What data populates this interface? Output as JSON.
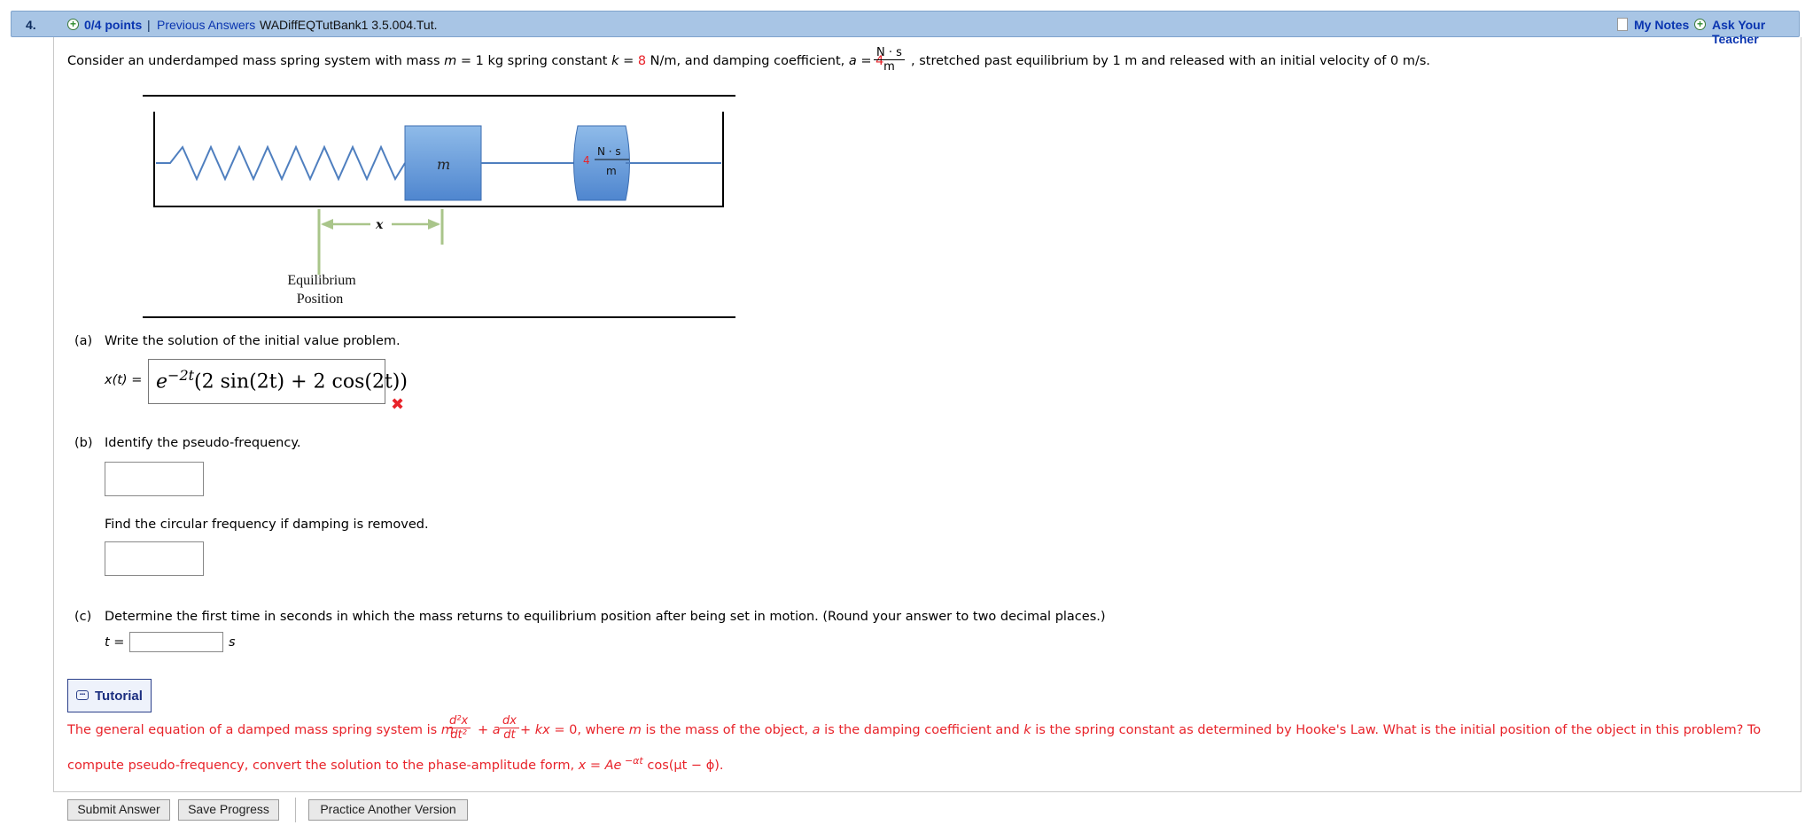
{
  "header": {
    "number": "4.",
    "points": "0/4 points",
    "separator": "|",
    "previous_answers": "Previous Answers",
    "code": "WADiffEQTutBank1 3.5.004.Tut.",
    "my_notes": "My Notes",
    "ask_teacher": "Ask Your Teacher"
  },
  "problem": {
    "p1": "Consider an underdamped mass spring system with mass ",
    "m_var": "m",
    "p2": " = 1 kg spring constant ",
    "k_var": "k",
    "p3": " = ",
    "k_val": "8",
    "p4": " N/m, and damping coefficient, ",
    "a_var": "a",
    "p5": " = ",
    "a_val": "4",
    "unit_num": "N · s",
    "unit_den": "m",
    "p6": ", stretched past equilibrium by 1 m and released with an initial velocity of 0 m/s."
  },
  "diagram": {
    "mass_label": "m",
    "damper_num": "N · s",
    "damper_den": "m",
    "damper_coef": "4",
    "x_label": "x",
    "equilibrium_line1": "Equilibrium",
    "equilibrium_line2": "Position"
  },
  "part_a": {
    "label": "(a)",
    "prompt": "Write the solution of the initial value problem.",
    "lhs": "x(t) =",
    "answer_base": "e",
    "answer_exp": "−2t",
    "answer_rest": "(2 sin(2t) + 2 cos(2t))",
    "status_icon": "✖"
  },
  "part_b": {
    "label": "(b)",
    "prompt": "Identify the pseudo-frequency.",
    "prompt2": "Find the circular frequency if damping is removed.",
    "value1": "",
    "value2": ""
  },
  "part_c": {
    "label": "(c)",
    "prompt": "Determine the first time in seconds in which the mass returns to equilibrium position after being set in motion. (Round your answer to two decimal places.)",
    "lhs": "t =",
    "unit": "s",
    "value": ""
  },
  "tutorial": {
    "label": "Tutorial",
    "icon": "chat-icon"
  },
  "hint": {
    "h1": "The general equation of a damped mass spring system is ",
    "m": "m",
    "d2x": "d²x",
    "dt2": "dt²",
    "plus": " + ",
    "a": "a",
    "dx": "dx",
    "dt": "dt",
    "h2": " + ",
    "kx": "kx",
    "h3": " = 0, where ",
    "h3m": "m",
    "h4": " is the mass of the object, ",
    "h4a": "a",
    "h5": " is the damping coefficient and ",
    "h5k": "k",
    "h6": " is the spring constant as determined by Hooke's Law. What is the initial position of the object in this problem? To",
    "line2_a": "compute pseudo-frequency, convert the solution to the phase-amplitude form, ",
    "line2_b": "x = Ae",
    "line2_exp": " −αt",
    "line2_c": " cos(μt − ϕ)",
    "line2_d": "."
  },
  "buttons": {
    "submit": "Submit Answer",
    "save": "Save Progress",
    "practice": "Practice Another Version"
  },
  "colors": {
    "header_bg": "#a8c5e5",
    "link": "#0a35b0",
    "accent_red": "#e8232a",
    "block_blue": "#5b93d6"
  }
}
